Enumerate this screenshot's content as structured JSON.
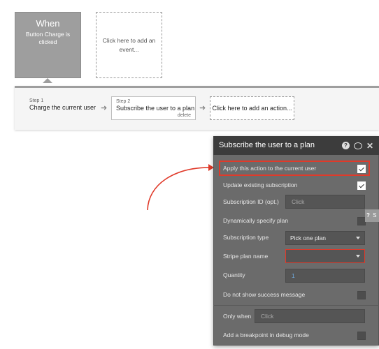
{
  "event": {
    "when_title": "When",
    "when_description": "Button Charge is clicked",
    "add_event": "Click here to add an event..."
  },
  "workflow": {
    "step1": {
      "label": "Step 1",
      "title": "Charge the current user"
    },
    "step2": {
      "label": "Step 2",
      "title": "Subscribe the user to a plan",
      "delete": "delete"
    },
    "add_action": "Click here to add an action...",
    "arrow_glyph": "➜"
  },
  "panel": {
    "title": "Subscribe the user to a plan",
    "icons": [
      "help-icon",
      "comment-icon",
      "close-icon"
    ],
    "help_glyph": "?",
    "close_glyph": "✕",
    "apply_current_user": {
      "label": "Apply this action to the current user",
      "checked": true
    },
    "update_existing": {
      "label": "Update existing subscription",
      "checked": true
    },
    "subscription_id": {
      "label": "Subscription ID (opt.)",
      "placeholder": "Click"
    },
    "dynamically_specify": {
      "label": "Dynamically specify plan",
      "checked": false
    },
    "subscription_type": {
      "label": "Subscription type",
      "value": "Pick one plan"
    },
    "stripe_plan_name": {
      "label": "Stripe plan name",
      "value": ""
    },
    "quantity": {
      "label": "Quantity",
      "value": "1"
    },
    "no_success_message": {
      "label": "Do not show success message",
      "checked": false
    },
    "only_when": {
      "label": "Only when",
      "placeholder": "Click"
    },
    "breakpoint": {
      "label": "Add a breakpoint in debug mode",
      "checked": false
    }
  },
  "side_tab": {
    "glyph": "?",
    "text": "S"
  },
  "colors": {
    "annotation_red": "#e03a2a",
    "panel_bg": "#6b6b6b",
    "panel_header": "#3c3c3c",
    "when_card": "#9e9e9e"
  }
}
